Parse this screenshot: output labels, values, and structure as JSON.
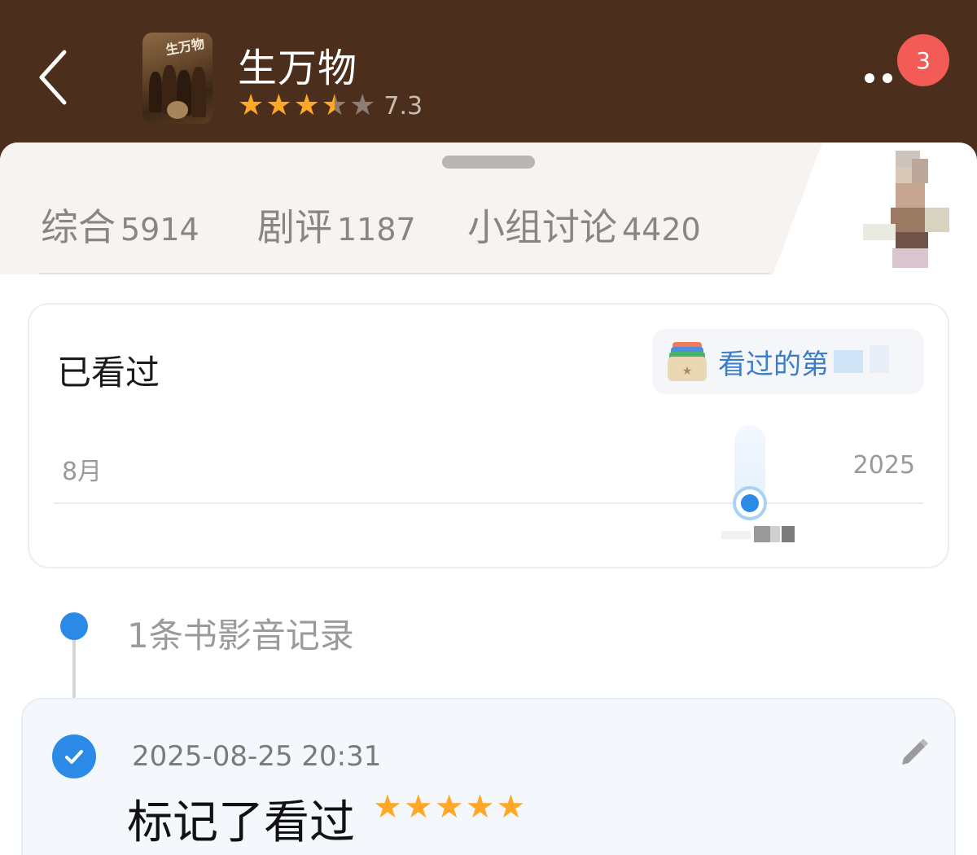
{
  "header": {
    "title": "生万物",
    "rating": {
      "value": "7.3",
      "stars": 3.5,
      "max_stars": 5
    },
    "poster_text": "生万物",
    "notification_count": "3",
    "icons": {
      "back": "back-chevron-icon",
      "more": "more-dots-icon"
    }
  },
  "tabs": [
    {
      "label": "综合",
      "count": "5914"
    },
    {
      "label": "剧评",
      "count": "1187"
    },
    {
      "label": "小组讨论",
      "count": "4420"
    }
  ],
  "watched_card": {
    "title": "已看过",
    "pill_label": "看过的第",
    "pill_icon": "card-stack-icon",
    "timeline": {
      "start_label": "8月",
      "end_label": "2025"
    }
  },
  "records": {
    "count_label": "1条书影音记录",
    "entries": [
      {
        "time": "2025-08-25 20:31",
        "action": "标记了看过",
        "stars": 5,
        "icon": "check-circle-icon",
        "edit_icon": "pencil-icon"
      }
    ]
  },
  "colors": {
    "header_bg": "#4b2e1b",
    "accent_blue": "#2b8ae6",
    "star_orange": "#ffa726",
    "badge_red": "#f35b56"
  }
}
